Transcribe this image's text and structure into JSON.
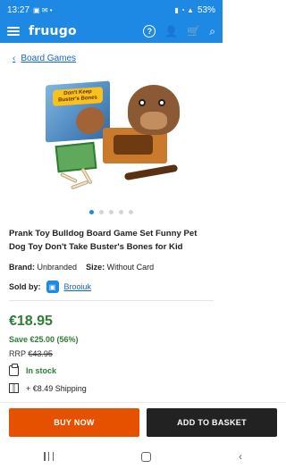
{
  "status_bar": {
    "time": "13:27",
    "battery": "53%"
  },
  "app": {
    "logo": "fruugo"
  },
  "breadcrumb": {
    "label": "Board Games"
  },
  "product": {
    "image_box_title": "Don't Keep Buster's Bones",
    "carousel": {
      "count": 5,
      "active_index": 0
    },
    "title": "Prank Toy Bulldog Board Game Set Funny Pet Dog Toy Don't Take Buster's Bones for Kid",
    "brand_label": "Brand:",
    "brand_value": "Unbranded",
    "size_label": "Size:",
    "size_value": "Without Card",
    "sold_by_label": "Sold by:",
    "seller": "Brooiuk"
  },
  "pricing": {
    "price": "€18.95",
    "save": "Save €25.00 (56%)",
    "rrp_label": "RRP",
    "rrp_old": "€43.95"
  },
  "availability": {
    "stock": "In stock",
    "shipping": "+ €8.49 Shipping"
  },
  "cta": {
    "buy_now": "BUY NOW",
    "add_to_basket": "ADD TO BASKET"
  },
  "colors": {
    "brand_blue": "#1e88e5",
    "price_green": "#2e7d32",
    "buy_orange": "#e65100",
    "basket_black": "#222222"
  }
}
